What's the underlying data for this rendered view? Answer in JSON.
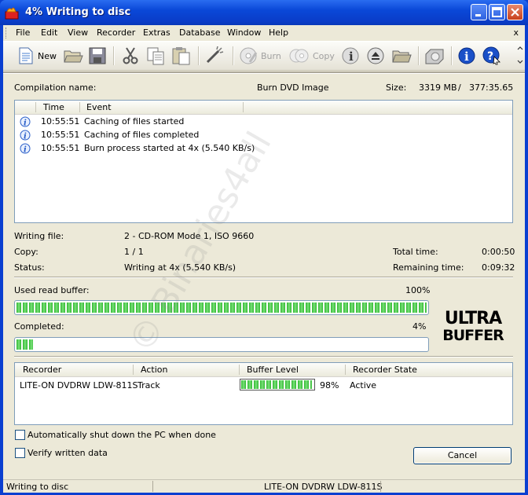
{
  "window": {
    "title": "4% Writing to disc"
  },
  "menu": {
    "file": "File",
    "edit": "Edit",
    "view": "View",
    "recorder": "Recorder",
    "extras": "Extras",
    "database": "Database",
    "window": "Window",
    "help": "Help",
    "close": "x"
  },
  "toolbar": {
    "new": "New",
    "burn": "Burn",
    "copy": "Copy"
  },
  "compilation": {
    "label": "Compilation name:",
    "value": "Burn DVD Image",
    "size_label": "Size:",
    "size_mb": "3319 MB",
    "slash": "/",
    "duration": "377:35.65"
  },
  "log": {
    "col_time": "Time",
    "col_event": "Event",
    "rows": [
      {
        "time": "10:55:51",
        "event": "Caching of files started"
      },
      {
        "time": "10:55:51",
        "event": "Caching of files completed"
      },
      {
        "time": "10:55:51",
        "event": "Burn process started at 4x (5.540 KB/s)"
      }
    ]
  },
  "info": {
    "writing_file_label": "Writing file:",
    "writing_file_value": "2 - CD-ROM Mode 1, ISO 9660",
    "copy_label": "Copy:",
    "copy_value": "1 / 1",
    "status_label": "Status:",
    "status_value": "Writing at 4x (5.540 KB/s)",
    "total_time_label": "Total time:",
    "total_time_value": "0:00:50",
    "remaining_label": "Remaining time:",
    "remaining_value": "0:09:32"
  },
  "buffer": {
    "label": "Used read buffer:",
    "percent_text": "100%",
    "fraction": 1.0
  },
  "completed": {
    "label": "Completed:",
    "percent_text": "4%",
    "fraction": 0.04
  },
  "logo": {
    "line1": "ULTRA",
    "line2": "BUFFER"
  },
  "recorders": {
    "col_recorder": "Recorder",
    "col_action": "Action",
    "col_buffer": "Buffer Level",
    "col_state": "Recorder State",
    "rows": [
      {
        "recorder": "LITE-ON DVDRW LDW-811S",
        "action": "Track",
        "buffer_text": "98%",
        "buffer_fraction": 0.98,
        "state": "Active"
      }
    ]
  },
  "options": {
    "shutdown": "Automatically shut down the PC when done",
    "verify": "Verify written data"
  },
  "buttons": {
    "cancel": "Cancel"
  },
  "statusbar": {
    "left": "Writing to disc",
    "device": "LITE-ON  DVDRW LDW-811S"
  },
  "watermark": "© Binaries4all",
  "colors": {
    "title_blue": "#0a48d8",
    "progress_green": "#30b830",
    "info_icon_blue": "#2a5ec8"
  }
}
